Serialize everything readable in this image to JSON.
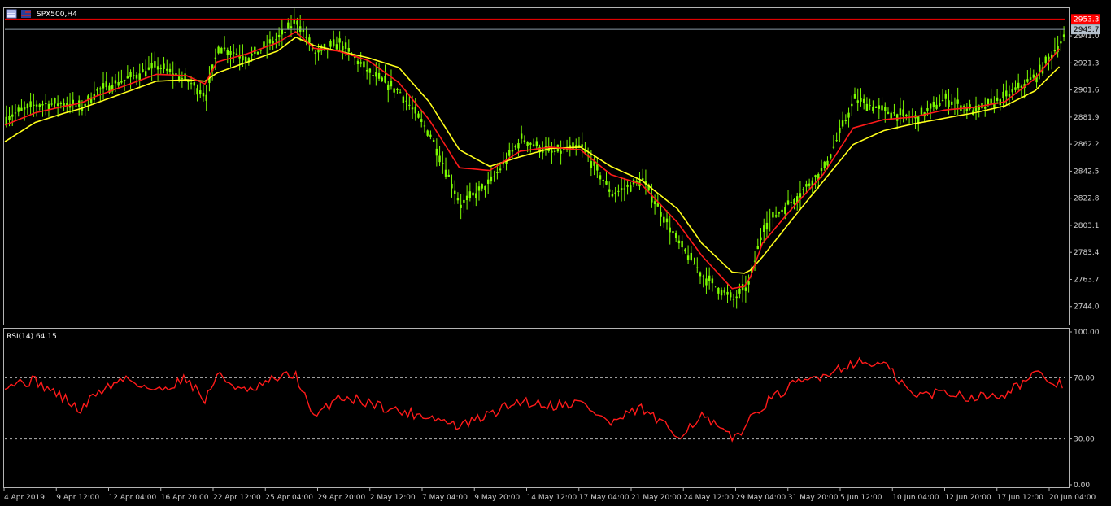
{
  "window": {
    "symbol_label": "SPX500,H4"
  },
  "colors": {
    "background": "#000000",
    "frame": "#b4b4b4",
    "candle": "#7cfc00",
    "ma_fast": "#ff1a1a",
    "ma_slow": "#ffff1a",
    "rsi_line": "#ff1a1a",
    "high_line": "#ff0000",
    "bid_line": "#8c9aa6",
    "level_grid": "#b4b4b4",
    "badge_high_bg": "#ff0000",
    "badge_bid_bg": "#b4c0cc"
  },
  "icons": [
    "chart-window-icon",
    "flag-icon"
  ],
  "chart_data": [
    {
      "type": "line",
      "name": "price-panel",
      "title": "SPX500,H4",
      "ylim": [
        2732,
        2960
      ],
      "price_ticks": [
        "2941.0",
        "2921.3",
        "2901.6",
        "2881.9",
        "2862.2",
        "2842.5",
        "2822.8",
        "2803.1",
        "2783.4",
        "2763.7",
        "2744.0"
      ],
      "high_price": 2953.3,
      "high_price_label": "2953.3",
      "bid_price": 2945.7,
      "bid_price_label": "2945.7",
      "x_index": [
        0,
        10,
        20,
        25,
        30,
        40,
        50,
        60,
        66,
        70,
        80,
        90,
        96,
        102,
        110,
        120,
        130,
        140,
        150,
        160,
        170,
        180,
        190,
        200,
        210,
        222,
        230,
        240,
        245,
        250,
        260,
        270,
        280,
        290,
        300,
        310,
        320,
        330,
        340,
        350
      ],
      "price_close": [
        2882,
        2891,
        2892,
        2889,
        2901,
        2910,
        2919,
        2908,
        2898,
        2933,
        2925,
        2940,
        2952,
        2928,
        2936,
        2914,
        2900,
        2869,
        2818,
        2835,
        2866,
        2856,
        2860,
        2826,
        2836,
        2790,
        2766,
        2749,
        2760,
        2803,
        2822,
        2845,
        2895,
        2886,
        2881,
        2895,
        2886,
        2897,
        2912,
        2943
      ],
      "ma_fast_values": [
        2876,
        2885,
        2890,
        2892,
        2897,
        2905,
        2913,
        2912,
        2906,
        2922,
        2928,
        2936,
        2944,
        2932,
        2930,
        2923,
        2907,
        2880,
        2845,
        2843,
        2857,
        2860,
        2858,
        2840,
        2833,
        2805,
        2781,
        2757,
        2759,
        2790,
        2816,
        2840,
        2874,
        2880,
        2882,
        2887,
        2889,
        2893,
        2910,
        2937
      ],
      "ma_slow_values": [
        2864,
        2878,
        2885,
        2888,
        2892,
        2900,
        2908,
        2909,
        2908,
        2914,
        2922,
        2930,
        2940,
        2934,
        2930,
        2925,
        2918,
        2893,
        2858,
        2846,
        2853,
        2859,
        2860,
        2846,
        2836,
        2815,
        2790,
        2769,
        2768,
        2780,
        2808,
        2835,
        2862,
        2872,
        2877,
        2881,
        2885,
        2890,
        2901,
        2923
      ]
    },
    {
      "type": "line",
      "name": "rsi-panel",
      "title": "RSI(14) 64.15",
      "ylim": [
        0,
        100
      ],
      "levels": [
        30,
        70
      ],
      "y_ticks": [
        "100.00",
        "70.00",
        "30.00",
        "0.00"
      ],
      "x_index": [
        0,
        10,
        20,
        25,
        30,
        40,
        50,
        60,
        66,
        70,
        80,
        90,
        96,
        102,
        110,
        120,
        130,
        140,
        150,
        160,
        170,
        180,
        190,
        200,
        210,
        222,
        230,
        240,
        245,
        250,
        260,
        270,
        280,
        290,
        300,
        310,
        320,
        330,
        340,
        350
      ],
      "values": [
        66,
        68,
        56,
        48,
        60,
        70,
        61,
        70,
        55,
        72,
        60,
        70,
        72,
        43,
        58,
        54,
        48,
        45,
        38,
        46,
        55,
        52,
        54,
        40,
        50,
        32,
        45,
        30,
        40,
        52,
        65,
        72,
        80,
        79,
        58,
        61,
        57,
        60,
        72,
        64
      ]
    }
  ],
  "time_axis": {
    "labels": [
      "4 Apr 2019",
      "9 Apr 12:00",
      "12 Apr 04:00",
      "16 Apr 20:00",
      "22 Apr 12:00",
      "25 Apr 04:00",
      "29 Apr 20:00",
      "2 May 12:00",
      "7 May 04:00",
      "9 May 20:00",
      "14 May 12:00",
      "17 May 04:00",
      "21 May 20:00",
      "24 May 12:00",
      "29 May 04:00",
      "31 May 20:00",
      "5 Jun 12:00",
      "10 Jun 04:00",
      "12 Jun 20:00",
      "17 Jun 12:00",
      "20 Jun 04:00"
    ]
  }
}
